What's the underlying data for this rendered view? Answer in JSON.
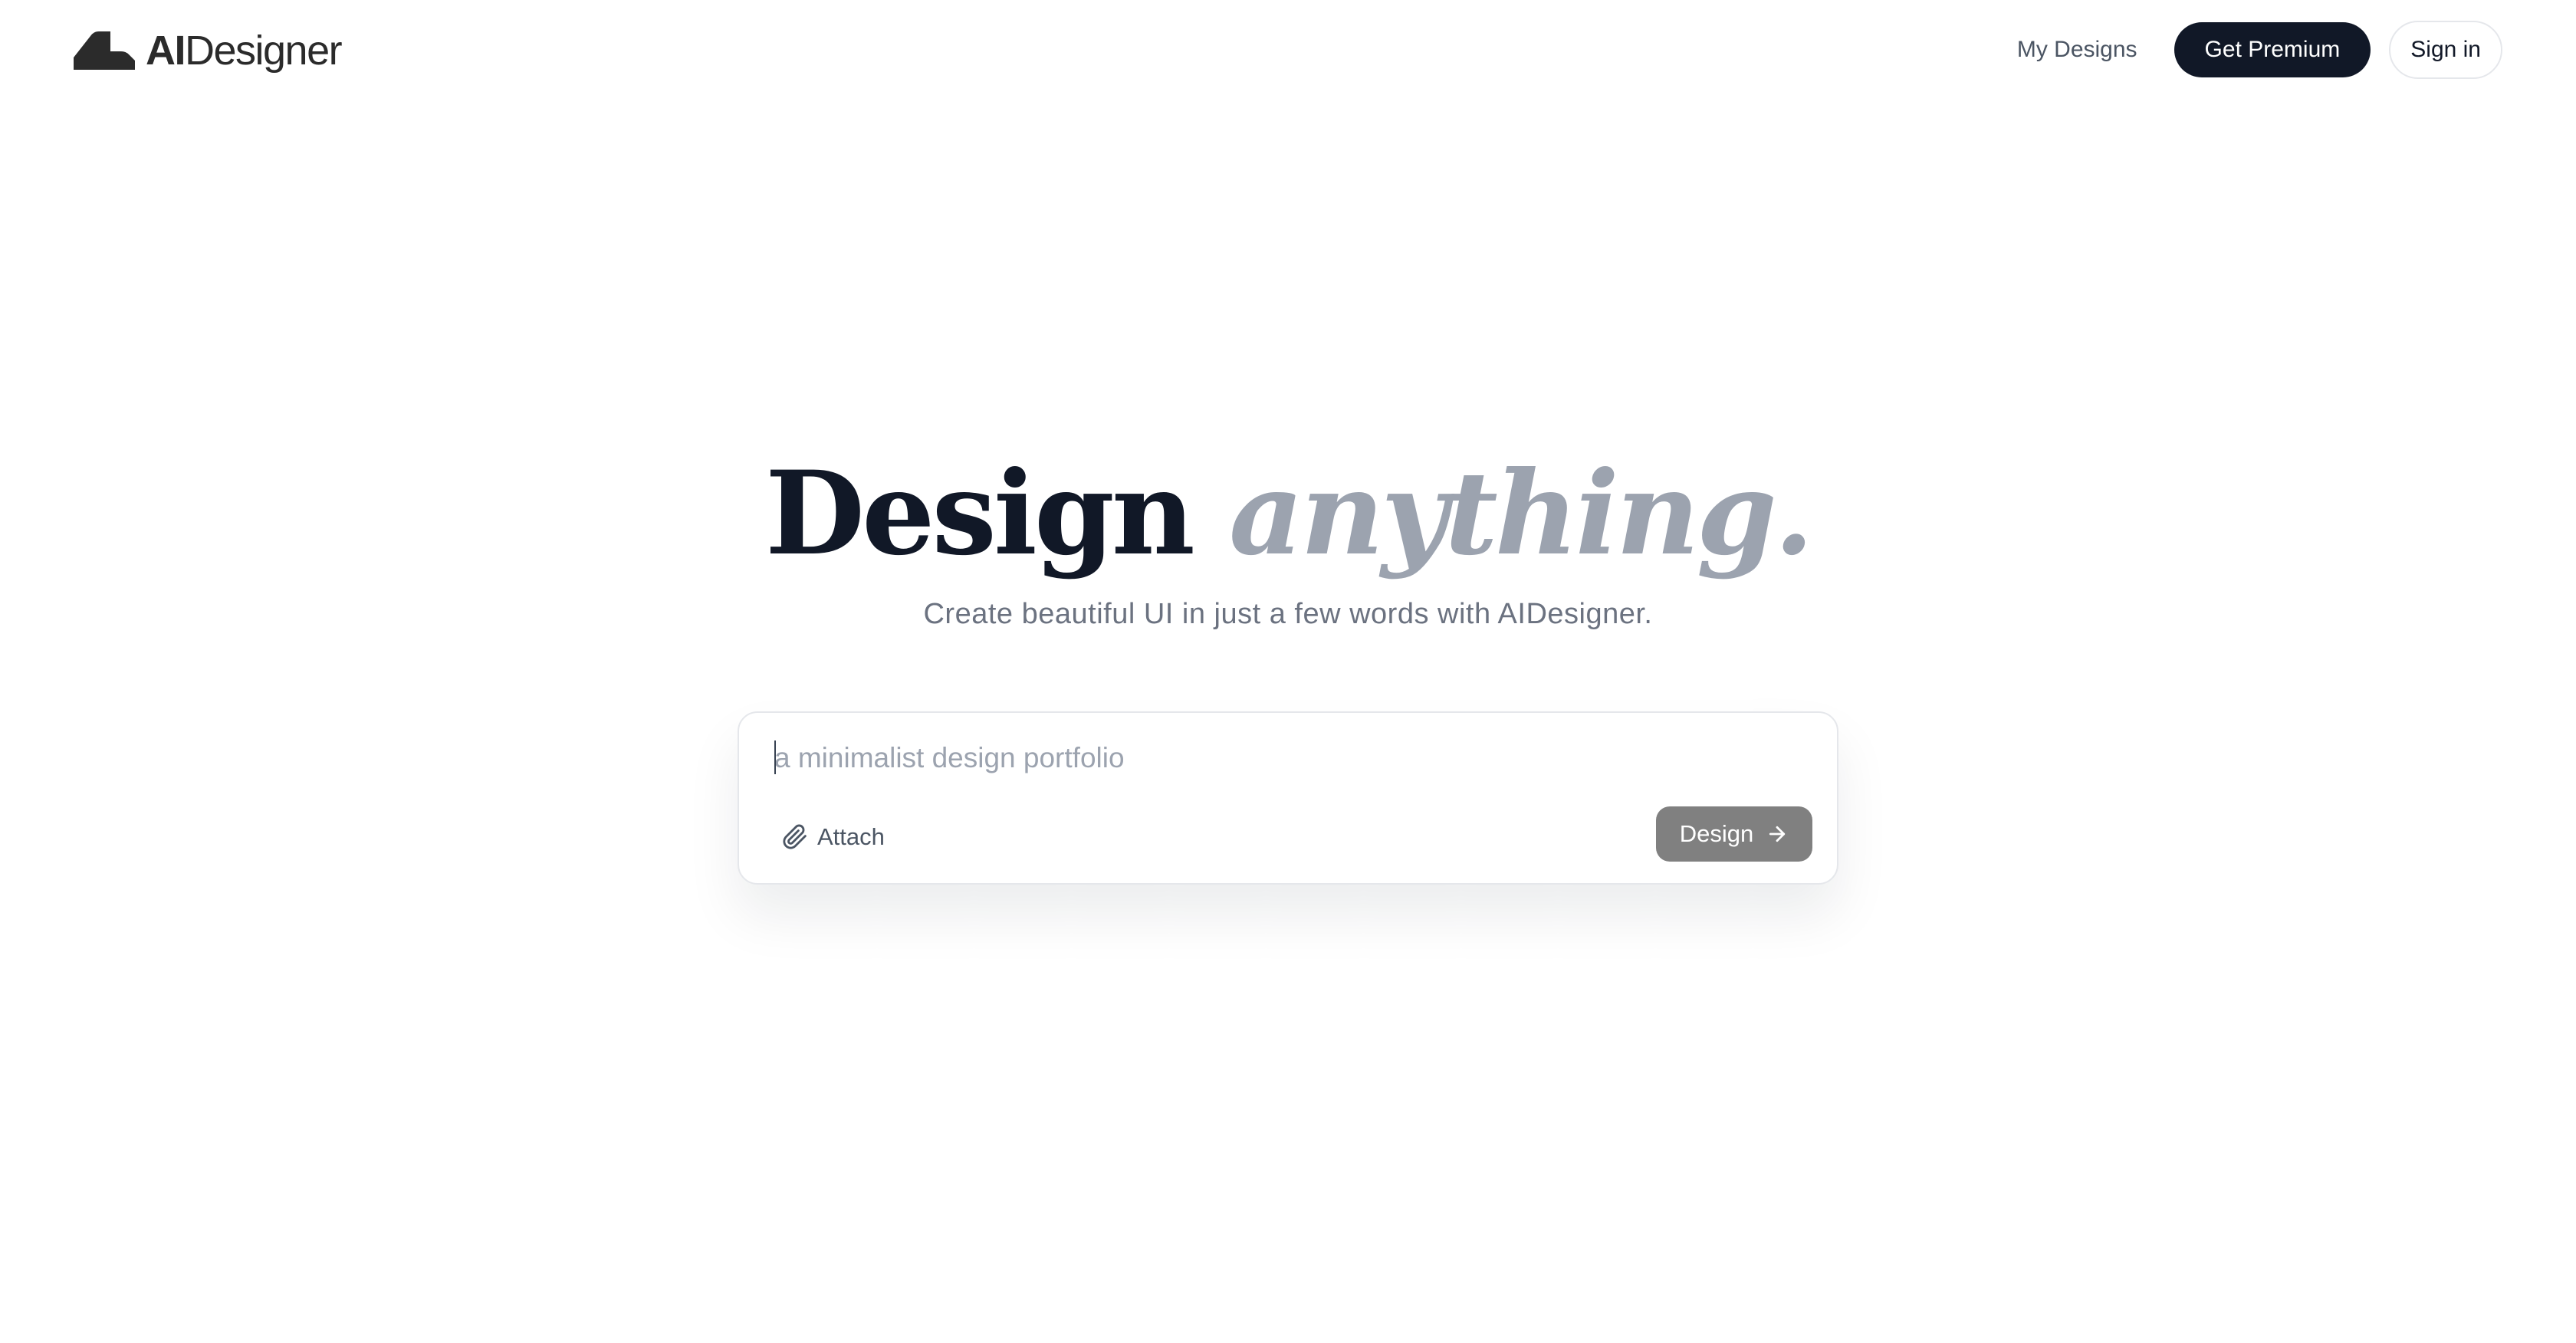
{
  "brand": {
    "name_bold": "AI",
    "name_regular": "Designer"
  },
  "nav": {
    "my_designs": "My Designs",
    "get_premium": "Get Premium",
    "sign_in": "Sign in"
  },
  "hero": {
    "title_main": "Design",
    "title_accent": "anything.",
    "subtitle": "Create beautiful UI in just a few words with AIDesigner."
  },
  "prompt": {
    "value": "",
    "placeholder": "a minimalist design portfolio",
    "attach_label": "Attach",
    "submit_label": "Design"
  },
  "icons": {
    "logo": "logo-mark-icon",
    "attach": "paperclip-icon",
    "submit": "arrow-right-icon"
  },
  "colors": {
    "primary": "#111827",
    "muted_text": "#6b7280",
    "accent_title": "#9ca3af",
    "design_button": "#808080",
    "border": "#e5e7eb"
  }
}
